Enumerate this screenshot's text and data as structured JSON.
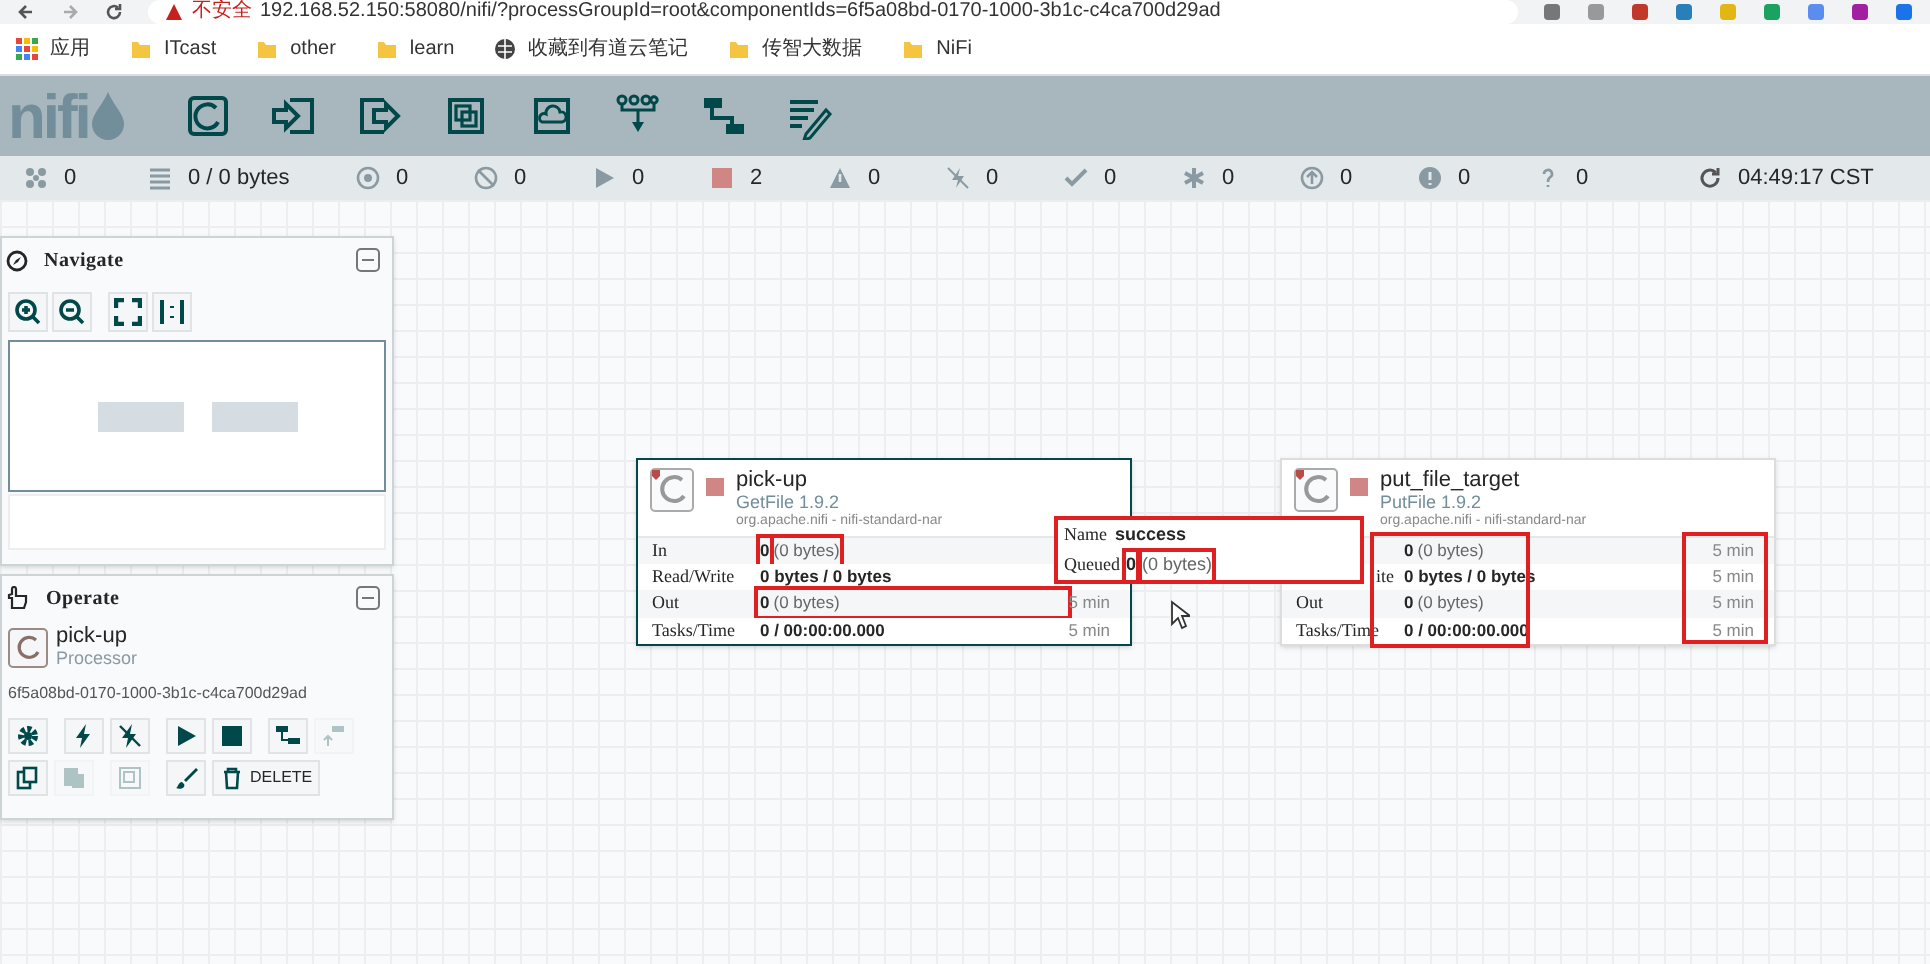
{
  "browser": {
    "security": "不安全",
    "url": "192.168.52.150:58080/nifi/?processGroupId=root&componentIds=6f5a08bd-0170-1000-3b1c-c4ca700d29ad",
    "bookmarks": [
      {
        "kind": "apps",
        "label": "应用"
      },
      {
        "kind": "folder",
        "label": "ITcast"
      },
      {
        "kind": "folder",
        "label": "other"
      },
      {
        "kind": "folder",
        "label": "learn"
      },
      {
        "kind": "globe",
        "label": "收藏到有道云笔记"
      },
      {
        "kind": "folder",
        "label": "传智大数据"
      },
      {
        "kind": "folder",
        "label": "NiFi"
      }
    ]
  },
  "logo": "nifi",
  "toolbar": [
    {
      "kind": "processor"
    },
    {
      "kind": "input-port"
    },
    {
      "kind": "output-port"
    },
    {
      "kind": "process-group"
    },
    {
      "kind": "remote-group"
    },
    {
      "kind": "funnel"
    },
    {
      "kind": "template"
    },
    {
      "kind": "label"
    }
  ],
  "status_bar": [
    {
      "kind": "cluster",
      "text": "0"
    },
    {
      "kind": "queue",
      "text": "0 / 0 bytes"
    },
    {
      "kind": "transmitting",
      "text": "0"
    },
    {
      "kind": "not-transmitting",
      "text": "0"
    },
    {
      "kind": "running",
      "text": "0"
    },
    {
      "kind": "stopped",
      "text": "2"
    },
    {
      "kind": "invalid",
      "text": "0"
    },
    {
      "kind": "disabled",
      "text": "0"
    },
    {
      "kind": "up-to-date",
      "text": "0"
    },
    {
      "kind": "modified",
      "text": "0"
    },
    {
      "kind": "stale",
      "text": "0"
    },
    {
      "kind": "error",
      "text": "0"
    },
    {
      "kind": "unknown",
      "text": "0"
    },
    {
      "kind": "refresh",
      "text": "04:49:17 CST"
    }
  ],
  "navigate": {
    "title": "Navigate",
    "tools": [
      {
        "kind": "zoom-in"
      },
      {
        "kind": "zoom-out"
      },
      {
        "kind": "fit"
      },
      {
        "kind": "actual-size"
      }
    ]
  },
  "operate": {
    "title": "Operate",
    "name": "pick-up",
    "type": "Processor",
    "id": "6f5a08bd-0170-1000-3b1c-c4ca700d29ad",
    "buttons": [
      {
        "kind": "configure",
        "disabled": false
      },
      {
        "kind": "enable",
        "disabled": false
      },
      {
        "kind": "disable",
        "disabled": false
      },
      {
        "kind": "start",
        "disabled": false
      },
      {
        "kind": "stop",
        "disabled": false
      },
      {
        "kind": "create-template",
        "disabled": false
      },
      {
        "kind": "upload-template",
        "disabled": true
      },
      {
        "kind": "copy",
        "disabled": false
      },
      {
        "kind": "paste",
        "disabled": true
      },
      {
        "kind": "group",
        "disabled": true
      },
      {
        "kind": "color",
        "disabled": false
      },
      {
        "kind": "delete",
        "label": "DELETE",
        "disabled": false
      }
    ]
  },
  "processors": [
    {
      "name": "pick-up",
      "type": "GetFile 1.9.2",
      "bundle": "org.apache.nifi - nifi-standard-nar",
      "stopped": true,
      "values_highlighted": false,
      "times_highlighted": false,
      "rows": [
        {
          "label": "In",
          "count": "0",
          "detail": "(0 bytes)",
          "count_highlighted": true,
          "detail_highlighted": true,
          "value_highlighted": false
        },
        {
          "label": "Read/Write",
          "count": "0 bytes / 0 bytes",
          "count_highlighted": false,
          "detail_highlighted": false,
          "value_highlighted": false
        },
        {
          "label": "Out",
          "count": "0",
          "detail": "(0 bytes)",
          "time": "5 min",
          "count_highlighted": false,
          "detail_highlighted": false,
          "value_highlighted": true
        },
        {
          "label": "Tasks/Time",
          "count": "0 / 00:00:00.000",
          "time": "5 min",
          "count_highlighted": false,
          "detail_highlighted": false,
          "value_highlighted": false
        }
      ]
    },
    {
      "name": "put_file_target",
      "type": "PutFile 1.9.2",
      "bundle": "org.apache.nifi - nifi-standard-nar",
      "stopped": true,
      "values_highlighted": true,
      "times_highlighted": true,
      "rows": [
        {
          "count": "0",
          "detail": "(0 bytes)",
          "time": "5 min",
          "count_highlighted": false,
          "detail_highlighted": false,
          "value_highlighted": false
        },
        {
          "label": "ite",
          "count": "0 bytes / 0 bytes",
          "time": "5 min",
          "count_highlighted": false,
          "detail_highlighted": false,
          "value_highlighted": false
        },
        {
          "label": "Out",
          "count": "0",
          "detail": "(0 bytes)",
          "time": "5 min",
          "count_highlighted": false,
          "detail_highlighted": false,
          "value_highlighted": false
        },
        {
          "label": "Tasks/Time",
          "count": "0 / 00:00:00.000",
          "time": "5 min",
          "count_highlighted": false,
          "detail_highlighted": false,
          "value_highlighted": false
        }
      ]
    }
  ],
  "connection": {
    "highlighted": true,
    "name_label": "Name",
    "name": "success",
    "queued_label": "Queued",
    "count": "0",
    "detail": "(0 bytes)",
    "count_highlighted": true,
    "detail_highlighted": true
  }
}
